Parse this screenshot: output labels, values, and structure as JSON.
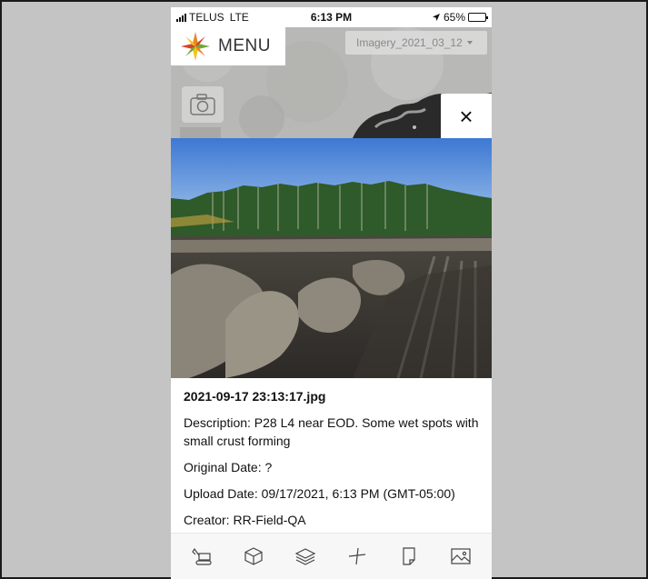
{
  "status_bar": {
    "carrier": "TELUS",
    "network": "LTE",
    "time": "6:13 PM",
    "battery": "65%",
    "battery_level": 0.65
  },
  "map": {
    "menu_label": "MENU",
    "imagery_value": "Imagery_2021_03_12",
    "camera_icon": "camera-icon",
    "close_label": "×"
  },
  "photo_details": {
    "filename": "2021-09-17 23:13:17.jpg",
    "description": "Description: P28 L4 near EOD. Some wet spots with small crust forming",
    "original_date": "Original Date: ?",
    "upload_date": "Upload Date: 09/17/2021, 6:13 PM (GMT-05:00)",
    "creator": "Creator: RR-Field-QA"
  },
  "toolbar": {
    "icons": [
      "excavator-icon",
      "box-3d-icon",
      "layers-icon",
      "measure-icon",
      "page-icon",
      "image-icon"
    ]
  },
  "colors": {
    "frame_bg": "#c4c4c4",
    "logo_orange": "#e8852a",
    "logo_green": "#6fa83a",
    "logo_yellow": "#f0c419",
    "logo_red": "#d6452a"
  }
}
